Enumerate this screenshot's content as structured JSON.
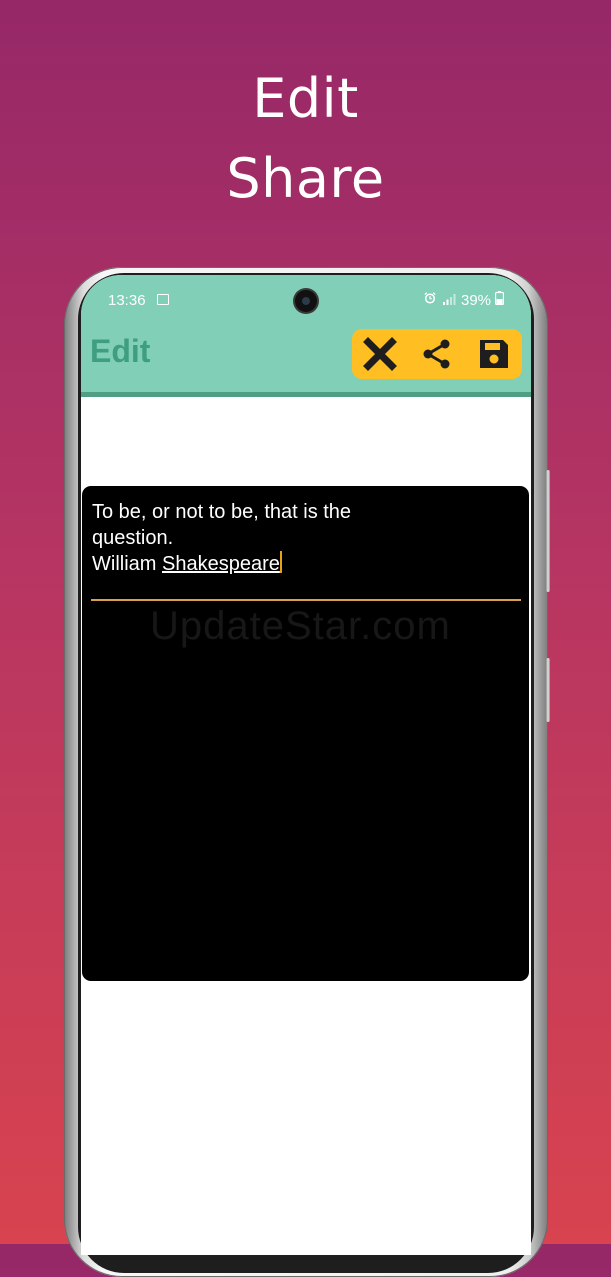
{
  "promo": {
    "line1": "Edit",
    "line2": "Share"
  },
  "status_bar": {
    "time": "13:36",
    "battery": "39%",
    "icons": [
      "image-icon",
      "alarm-icon",
      "signal-icon",
      "battery-icon"
    ]
  },
  "app_bar": {
    "title": "Edit",
    "actions": [
      {
        "name": "close",
        "icon": "close-icon"
      },
      {
        "name": "share",
        "icon": "share-icon"
      },
      {
        "name": "save",
        "icon": "save-icon"
      }
    ]
  },
  "editor": {
    "line1": "To be, or not to be, that is the question.",
    "line2_prefix": "William ",
    "line2_underlined": "Shakespeare"
  },
  "watermark": "UpdateStar.com",
  "colors": {
    "gradient_top": "#962868",
    "gradient_bottom": "#d8434f",
    "app_bar": "#80cfb6",
    "title": "#3f9e80",
    "action_box": "#ffbf23",
    "editor_bg": "#000000",
    "caret": "#e8a218"
  }
}
